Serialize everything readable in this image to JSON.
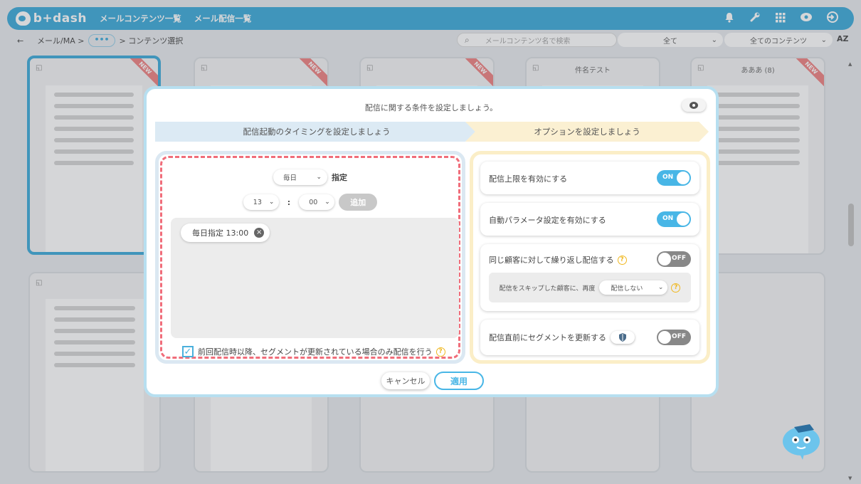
{
  "topbar": {
    "logo_text": "b+dash",
    "nav": [
      "メールコンテンツ一覧",
      "メール配信一覧"
    ],
    "icons": [
      "bell-icon",
      "wrench-icon",
      "grid-icon",
      "chat-icon",
      "logout-icon"
    ]
  },
  "subbar": {
    "back": "←",
    "crumb1": "メール/MA >",
    "dots": "•••",
    "crumb2": "> コンテンツ選択",
    "search_placeholder": "メールコンテンツ名で検索",
    "filter1": "全て",
    "filter2": "全てのコンテンツ",
    "sort_label": "AZ"
  },
  "cards": [
    {
      "title": "",
      "new": true
    },
    {
      "title": "",
      "new": true
    },
    {
      "title": "",
      "new": true
    },
    {
      "title": "件名テスト",
      "new": false
    },
    {
      "title": "あああ (8)",
      "new": true
    }
  ],
  "modal": {
    "header": "配信に関する条件を設定しましょう。",
    "step1": "配信起動のタイミングを設定しましょう",
    "step2": "オプションを設定しましょう",
    "frequency": "毎日",
    "frequency_suffix": "指定",
    "hour": "13",
    "colon": ":",
    "minute": "00",
    "add_button": "追加",
    "schedule_chip": "毎日指定 13:00",
    "chip_remove": "×",
    "check_label": "前回配信時以降、セグメントが更新されている場合のみ配信を行う",
    "check_mark": "✓",
    "help_q": "?",
    "options": [
      {
        "label": "配信上限を有効にする",
        "state": "ON"
      },
      {
        "label": "自動パラメータ設定を有効にする",
        "state": "ON"
      },
      {
        "label": "同じ顧客に対して繰り返し配信する",
        "state": "OFF"
      },
      {
        "label": "配信直前にセグメントを更新する",
        "state": "OFF"
      }
    ],
    "repeat_sub_label": "配信をスキップした顧客に、再度",
    "repeat_sub_select": "配信しない",
    "cancel": "キャンセル",
    "apply": "適用"
  },
  "colors": {
    "brand": "#4ab0dc",
    "toggle_on": "#48b6e6",
    "dashed_border": "#f06d7a",
    "step1_bg": "#dceaf4",
    "step2_bg": "#fbf0d2"
  }
}
